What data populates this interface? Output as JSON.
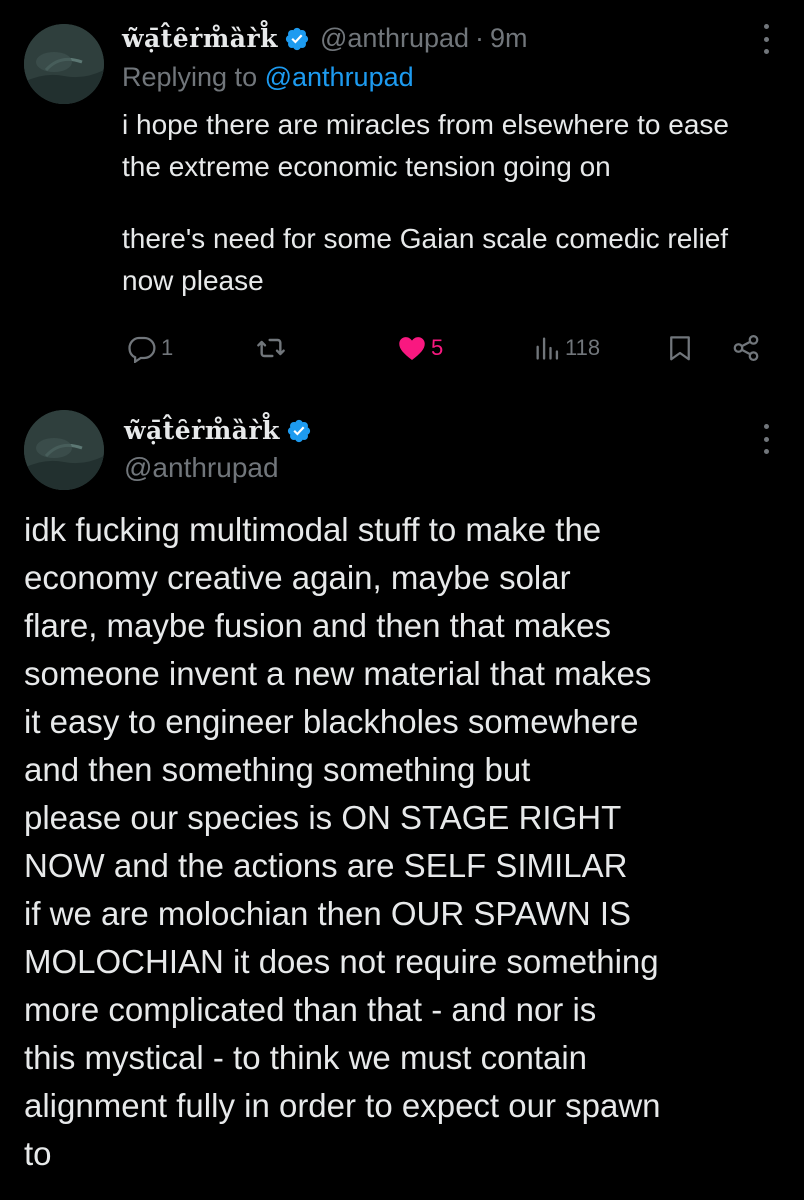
{
  "reply_tweet": {
    "author_name": "w̃ạ̄t̂ȇṙm̊ȁr̀k̊",
    "handle": "@anthrupad",
    "dot": "·",
    "time": "9m",
    "replying_prefix": "Replying to",
    "replying_handle": "@anthrupad",
    "paragraphs": [
      "i hope there are miracles from elsewhere to ease the extreme economic tension going on",
      "there's need for some Gaian scale comedic relief now please"
    ],
    "stats": {
      "replies": "1",
      "likes": "5",
      "views": "118"
    },
    "colors": {
      "like": "#f91880",
      "muted": "#71767b",
      "link": "#1d9bf0"
    }
  },
  "main_tweet": {
    "author_name": "w̃ạ̄t̂ȇṙm̊ȁr̀k̊",
    "handle": "@anthrupad",
    "text": "idk fucking multimodal stuff to make the\neconomy creative again, maybe solar\nflare, maybe fusion and then that makes\nsomeone invent a new material that makes\nit easy to engineer blackholes somewhere\nand then something something but\nplease our species is ON STAGE RIGHT\nNOW and the actions are SELF SIMILAR\nif we are molochian then OUR SPAWN IS\nMOLOCHIAN it does not require something\nmore complicated than that - and nor is\nthis mystical - to think we must contain\nalignment fully in order to expect our spawn\nto"
  },
  "icons": {
    "reply": "reply-icon",
    "retweet": "retweet-icon",
    "like": "heart-icon",
    "views": "views-icon",
    "bookmark": "bookmark-icon",
    "share": "share-icon",
    "verified": "verified-badge-icon",
    "more": "more-options-icon"
  }
}
